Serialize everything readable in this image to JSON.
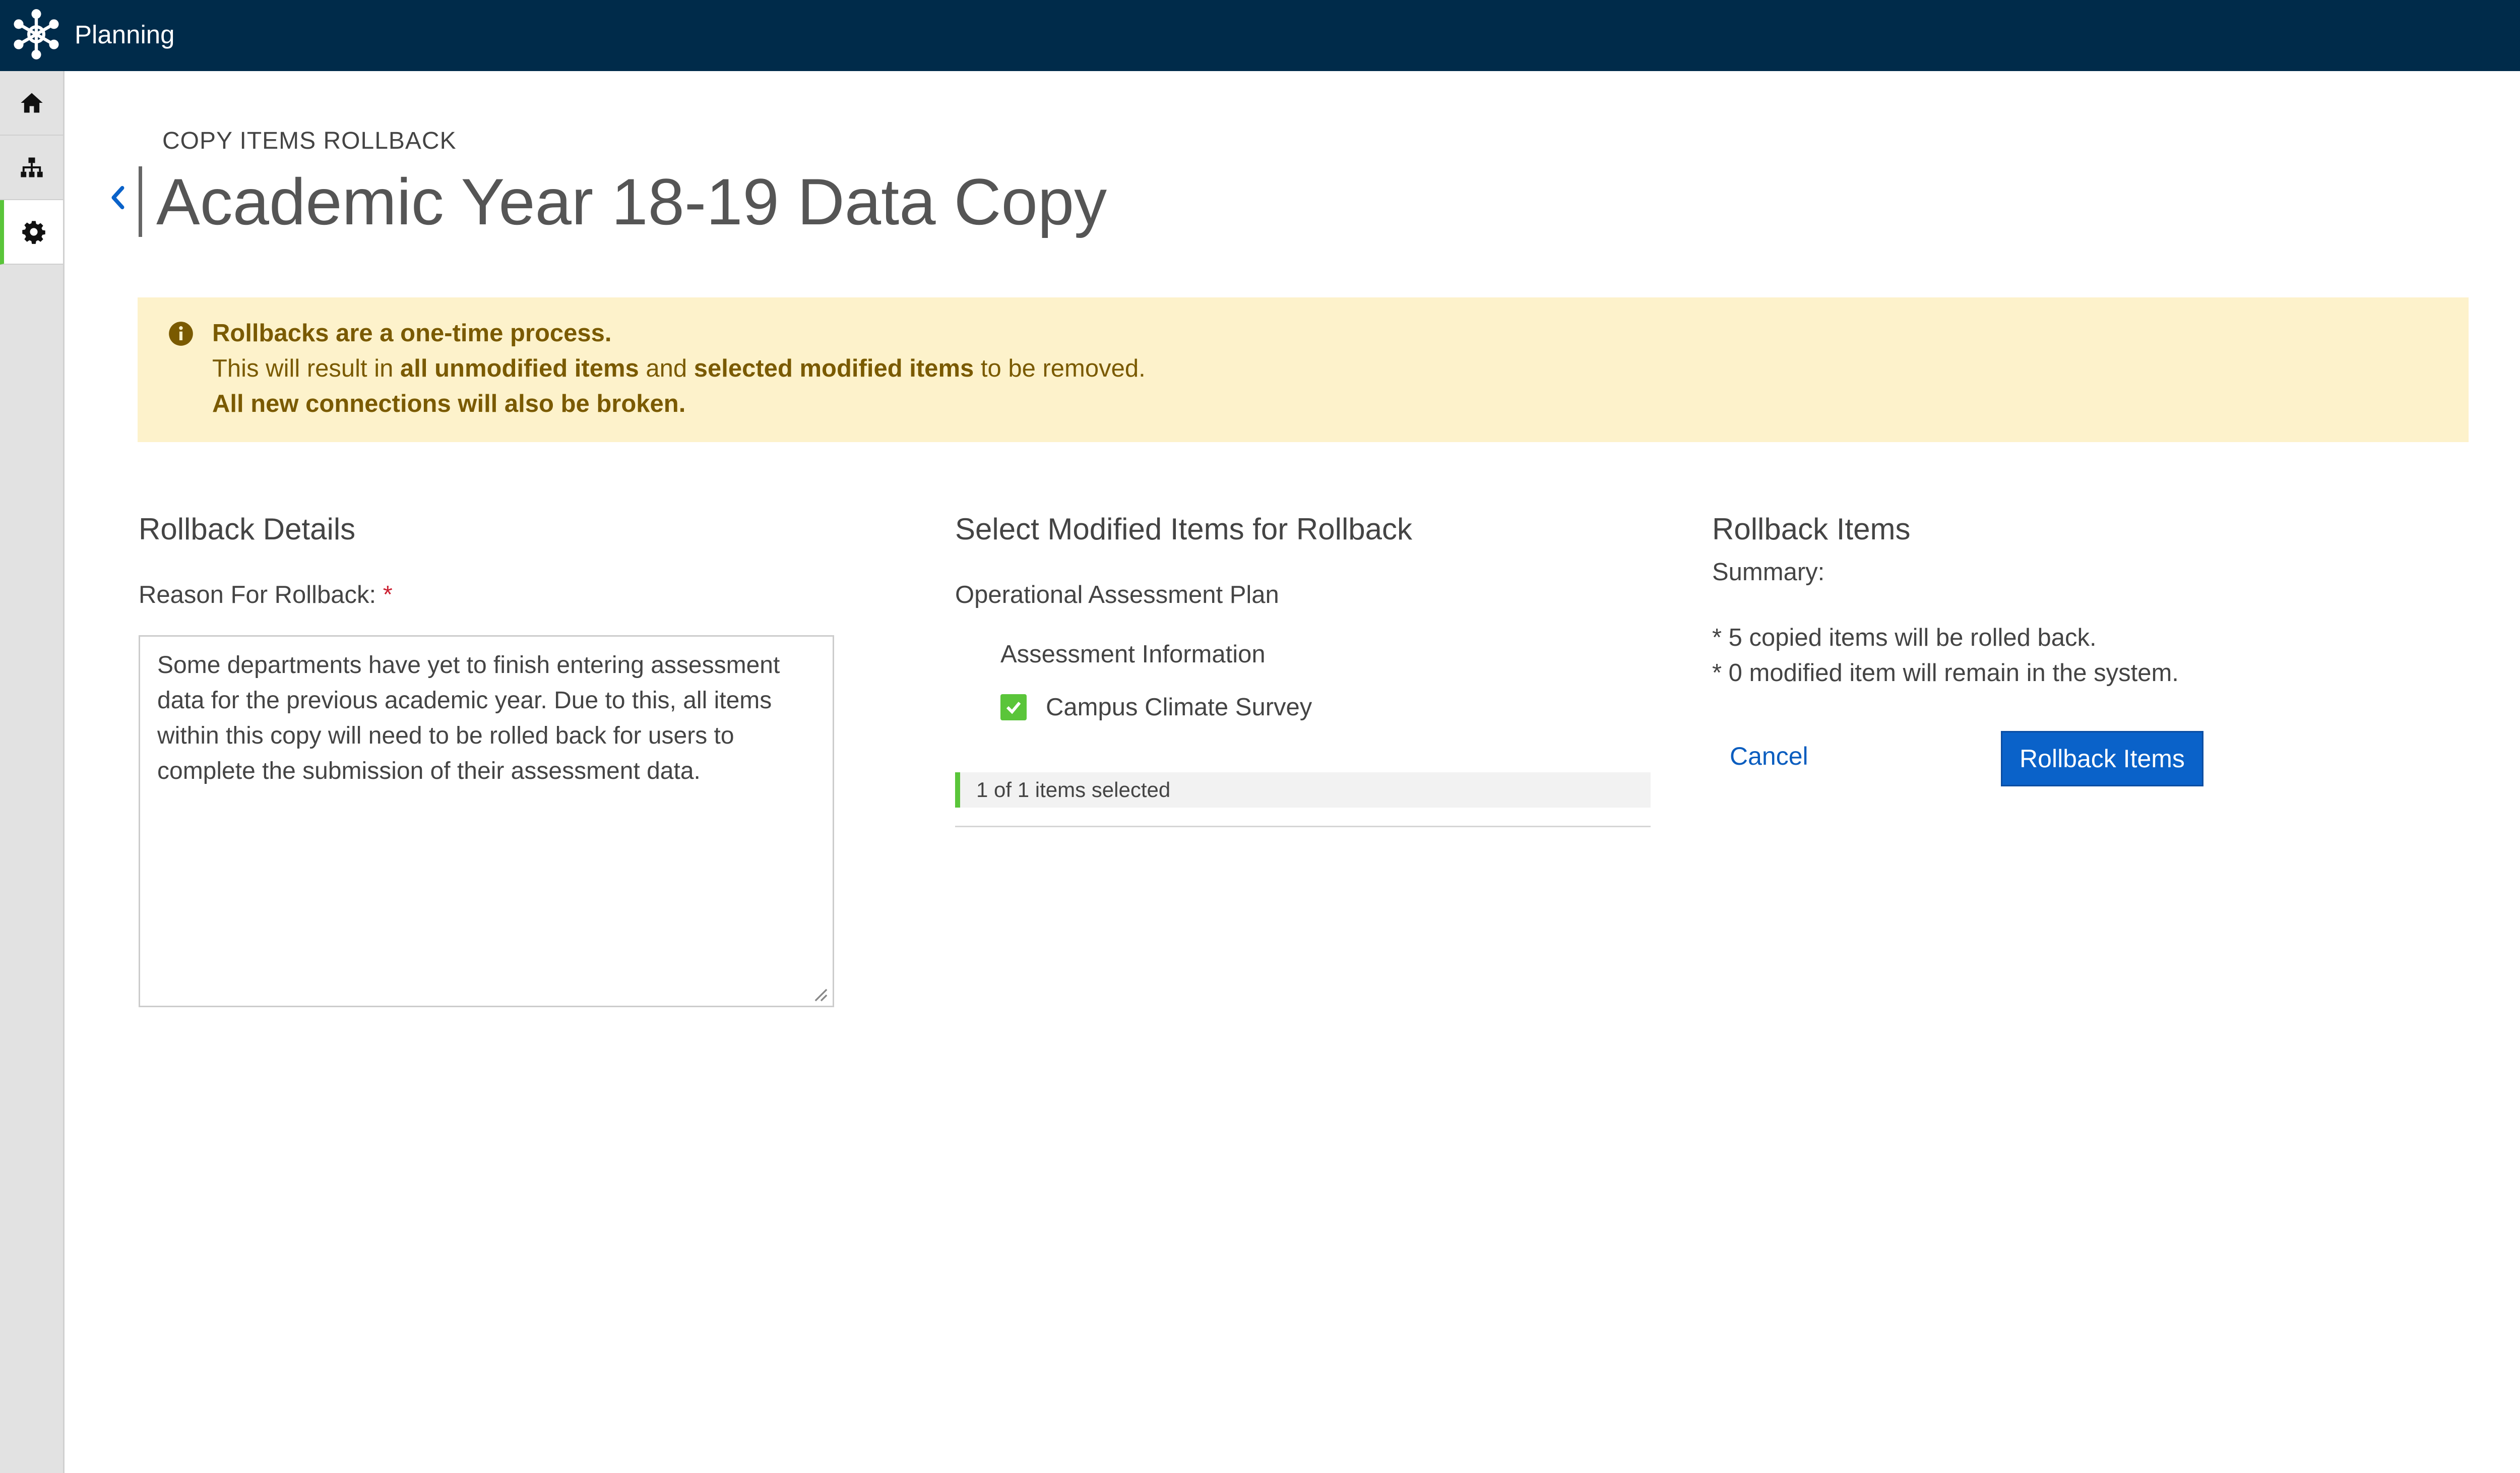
{
  "app": {
    "name": "Planning",
    "logo_icon": "network-hub-icon"
  },
  "sidebar": {
    "items": [
      {
        "icon": "home-icon",
        "active": false
      },
      {
        "icon": "sitemap-icon",
        "active": false
      },
      {
        "icon": "gear-icon",
        "active": true
      }
    ]
  },
  "header": {
    "eyebrow": "COPY ITEMS ROLLBACK",
    "title": "Academic Year 18-19 Data Copy",
    "back_icon": "chevron-left-icon"
  },
  "alert": {
    "icon": "info-circle-icon",
    "line1": "Rollbacks are a one-time process.",
    "line2_prefix": "This will result in ",
    "line2_bold1": "all unmodified items",
    "line2_mid": " and ",
    "line2_bold2": "selected modified items",
    "line2_suffix": " to be removed.",
    "line3": "All new connections will also be broken."
  },
  "details": {
    "title": "Rollback Details",
    "reason_label": "Reason For Rollback:",
    "required_mark": "*",
    "reason_value": "Some departments have yet to finish entering assessment data for the previous academic year. Due to this, all items within this copy will need to be rolled back for users to complete the submission of their assessment data."
  },
  "selection": {
    "title": "Select Modified Items for Rollback",
    "plan": "Operational Assessment Plan",
    "section": "Assessment Information",
    "item": {
      "label": "Campus Climate Survey",
      "checked": true
    },
    "count_text": "1 of 1 items selected"
  },
  "rollback": {
    "title": "Rollback Items",
    "summary_label": "Summary:",
    "summary_lines": [
      "* 5 copied items will be rolled back.",
      "* 0 modified item will remain in the system."
    ],
    "cancel_label": "Cancel",
    "submit_label": "Rollback Items"
  },
  "colors": {
    "topbar": "#002b4a",
    "accent_green": "#5ac53a",
    "primary_blue": "#0a62c9",
    "alert_bg": "#fdf2cb",
    "alert_text": "#7a5a00"
  }
}
